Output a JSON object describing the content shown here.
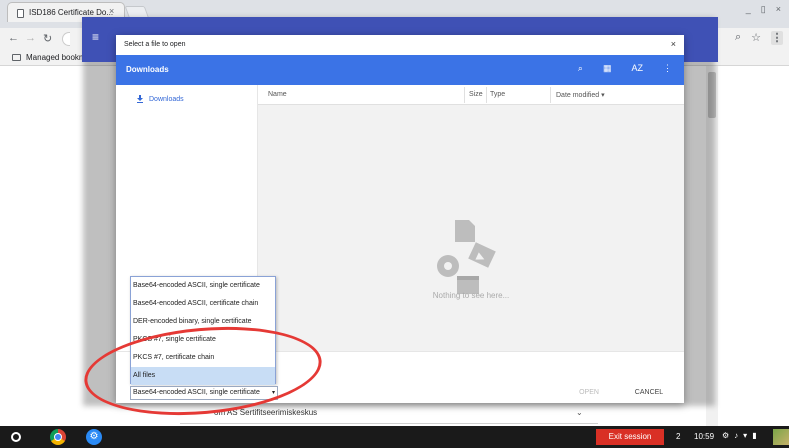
{
  "browser": {
    "tab_title": "ISD186 Certificate Do...",
    "tab_close": "×",
    "window_controls": [
      "_",
      "▯",
      "×"
    ],
    "bookmarks_label": "Managed bookma"
  },
  "page": {
    "select_label": "om AS Sertifitseerimiskeskus",
    "select_caret": "⌄"
  },
  "dialog": {
    "title": "Select a file to open",
    "close": "×",
    "header_title": "Downloads",
    "sidebar_item": "Downloads",
    "columns": {
      "name": "Name",
      "size": "Size",
      "type": "Type",
      "date": "Date modified ▾"
    },
    "empty_text": "Nothing to see here...",
    "open_label": "OPEN",
    "cancel_label": "CANCEL",
    "header_icons": {
      "search": "⌕",
      "grid": "▦",
      "sort": "AZ",
      "menu": "⋮"
    },
    "colors": {
      "header": "#3b73e6",
      "back_bar": "#3f51b5",
      "accent_text": "#3367d6"
    }
  },
  "file_types": {
    "options": [
      "Base64-encoded ASCII, single certificate",
      "Base64-encoded ASCII, certificate chain",
      "DER-encoded binary, single certificate",
      "PKCS #7, single certificate",
      "PKCS #7, certificate chain",
      "All files"
    ],
    "highlighted_index": 5,
    "selected_value": "Base64-encoded ASCII, single certificate"
  },
  "shelf": {
    "exit_label": "Exit session",
    "count": "2",
    "time": "10:59",
    "exit_color": "#d93025"
  }
}
